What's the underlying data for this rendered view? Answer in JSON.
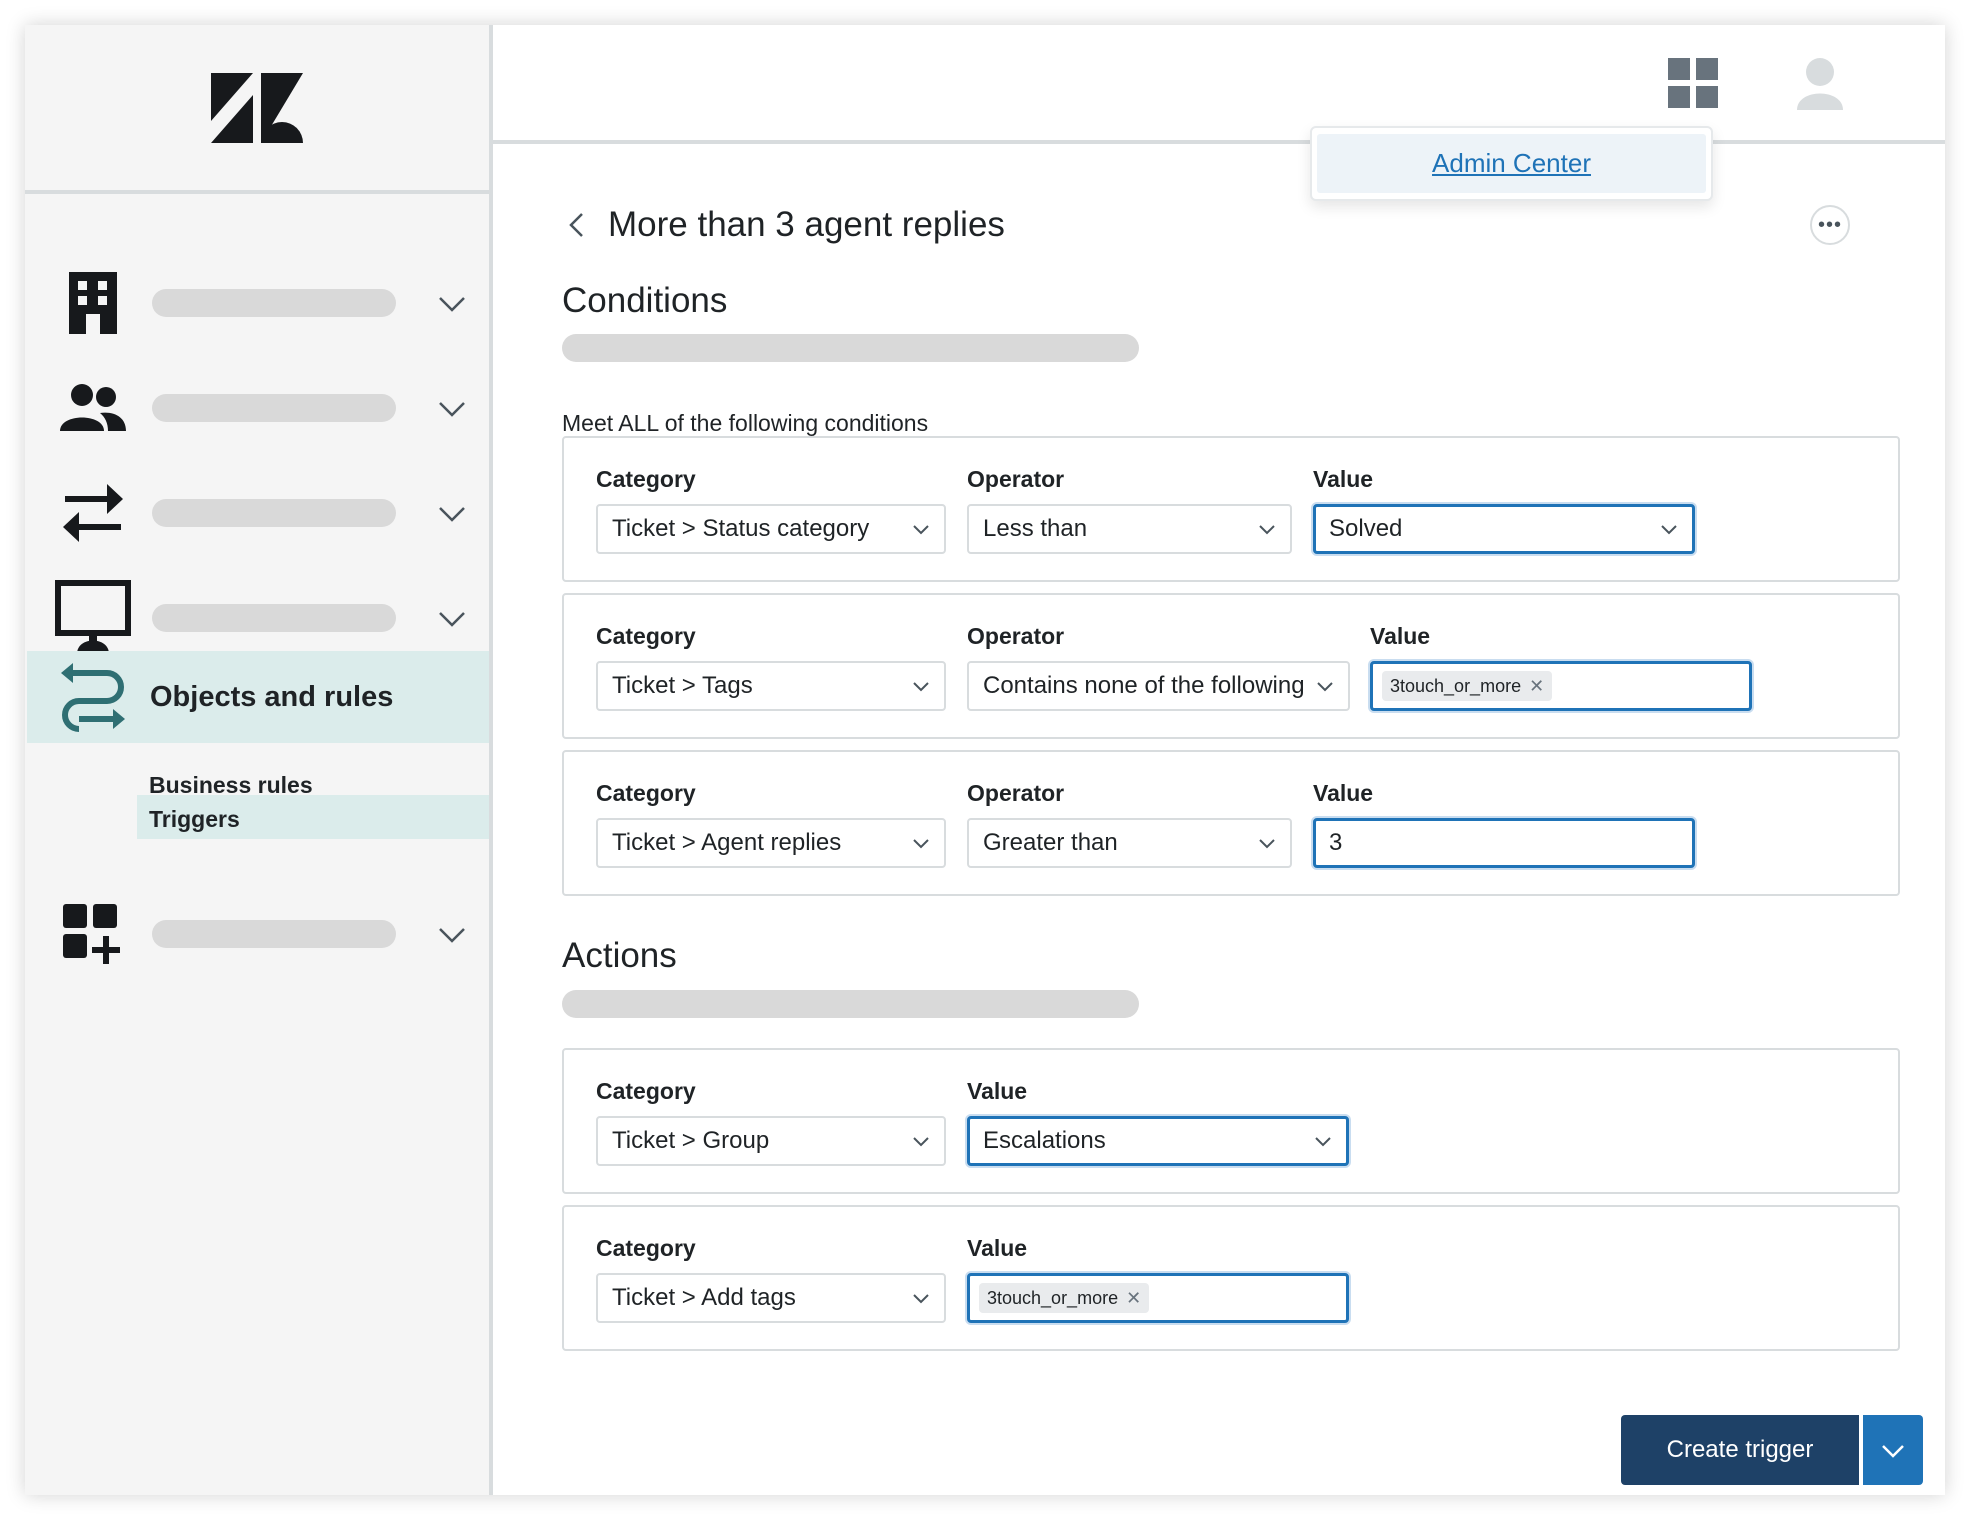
{
  "topbar": {
    "admin_center_link": "Admin Center",
    "icons": [
      "apps-grid-icon",
      "user-avatar-icon"
    ]
  },
  "sidebar": {
    "logo": "zendesk-logo",
    "active_item_label": "Objects and rules",
    "sub_items": [
      "Business rules",
      "Triggers"
    ],
    "active_sub_item": "Triggers",
    "icons": [
      "building-icon",
      "people-icon",
      "arrows-exchange-icon",
      "monitor-icon",
      "objects-rules-icon",
      "apps-add-icon"
    ]
  },
  "page": {
    "title": "More than 3 agent replies"
  },
  "conditions": {
    "section_title": "Conditions",
    "meet_label": "Meet ALL of the following conditions",
    "rows": [
      {
        "category_label": "Category",
        "category_value": "Ticket > Status category",
        "operator_label": "Operator",
        "operator_value": "Less than",
        "value_label": "Value",
        "value_value": "Solved"
      },
      {
        "category_label": "Category",
        "category_value": "Ticket > Tags",
        "operator_label": "Operator",
        "operator_value": "Contains none of the following",
        "value_label": "Value",
        "value_tag": "3touch_or_more"
      },
      {
        "category_label": "Category",
        "category_value": "Ticket > Agent replies",
        "operator_label": "Operator",
        "operator_value": "Greater than",
        "value_label": "Value",
        "value_value": "3"
      }
    ]
  },
  "actions": {
    "section_title": "Actions",
    "rows": [
      {
        "category_label": "Category",
        "category_value": "Ticket > Group",
        "value_label": "Value",
        "value_value": "Escalations"
      },
      {
        "category_label": "Category",
        "category_value": "Ticket > Add tags",
        "value_label": "Value",
        "value_tag": "3touch_or_more"
      }
    ]
  },
  "footer": {
    "create_button_label": "Create trigger"
  },
  "colors": {
    "brand_dark": "#1e4167",
    "accent_blue": "#1f73b7",
    "active_nav_bg": "#dbeceb",
    "teal_icon": "#2f6f73"
  }
}
